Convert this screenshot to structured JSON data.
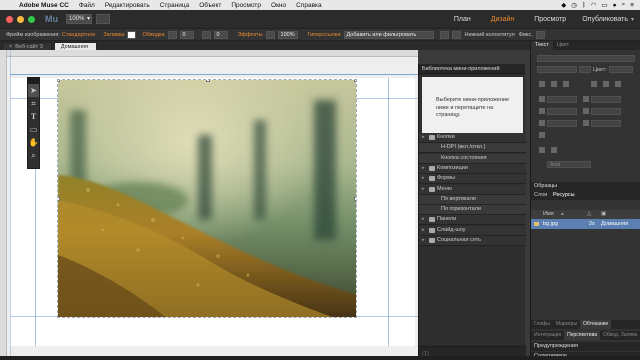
{
  "menubar": {
    "app_name": "Adobe Muse CC",
    "items": [
      "Файл",
      "Редактировать",
      "Страница",
      "Объект",
      "Просмотр",
      "Окно",
      "Справка"
    ]
  },
  "appbar": {
    "logo": "Mu",
    "zoom": "100%",
    "modes": [
      "План",
      "Дизайн",
      "Просмотр"
    ],
    "active_mode": "Дизайн",
    "publish": "Опубликовать"
  },
  "ctrlbar": {
    "frame_label": "Фрейм изображения:",
    "frame_value": "Стандартное",
    "fill_label": "Заливка",
    "stroke_label": "Обводка",
    "stroke_value": "0",
    "radius_value": "0",
    "effects_label": "Эффекты",
    "opacity_value": "100%",
    "hyperlink_label": "Гиперссылки",
    "hyperlink_value": "Добавить или фильтровать",
    "footer_label": "Нижний колонтитул",
    "fixed_label": "Фикс."
  },
  "tabs": {
    "items": [
      {
        "label": "Веб-сайт 3"
      },
      {
        "label": "Домашняя"
      }
    ]
  },
  "library": {
    "title": "Библиотека мини-приложений",
    "hint": "Выберите мини-приложение ниже и перетащите на страницу.",
    "rows": [
      {
        "label": "Кнопки",
        "kind": "cat"
      },
      {
        "label": "H-DPI (вкл./откл.)",
        "kind": "sub"
      },
      {
        "label": "Кнопка состояния",
        "kind": "sub"
      },
      {
        "label": "Композиции",
        "kind": "cat"
      },
      {
        "label": "Формы",
        "kind": "cat"
      },
      {
        "label": "Меню",
        "kind": "cat"
      },
      {
        "label": "По вертикали",
        "kind": "sub"
      },
      {
        "label": "По горизонтали",
        "kind": "sub"
      },
      {
        "label": "Панели",
        "kind": "cat"
      },
      {
        "label": "Слайд-шоу",
        "kind": "cat"
      },
      {
        "label": "Социальная сеть",
        "kind": "cat"
      }
    ]
  },
  "right_panel": {
    "tabs": [
      "Текст",
      "Цвет"
    ],
    "color_label": "Цвет:",
    "font_value": "Arial",
    "samples_label": "Образцы",
    "asset_tabs": [
      "Слои",
      "Ресурсы"
    ],
    "col_name": "Имя",
    "asset": {
      "name": "bg.jpg",
      "scale": "2x",
      "page": "Домашняя"
    },
    "bottom_tabs1": [
      "Глифы",
      "Маркеры",
      "Обтекание"
    ],
    "bottom_tabs2": [
      "Интеграция",
      "Перспектива",
      "Обвод. Заливк."
    ],
    "preview_label": "Предупреждения",
    "content_label": "Содержимое"
  },
  "colors": {
    "accent": "#e88a2e",
    "selection": "#5b7fb1"
  }
}
